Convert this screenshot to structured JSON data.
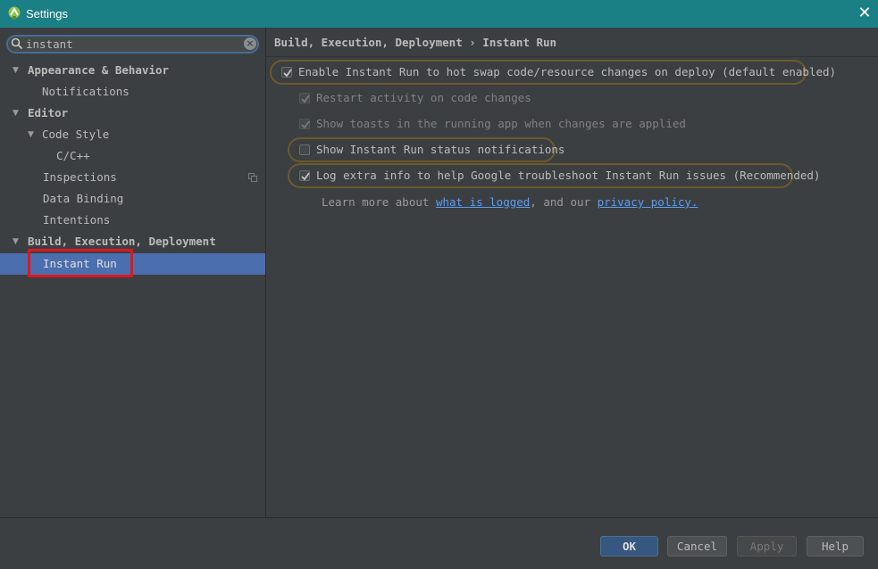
{
  "window": {
    "title": "Settings",
    "close_glyph": "✕",
    "icon": "android-studio-icon"
  },
  "search": {
    "value": "instant",
    "icon": "search-icon",
    "clear_glyph": "×"
  },
  "tree": {
    "appearance": "Appearance & Behavior",
    "notifications": "Notifications",
    "editor": "Editor",
    "code_style": "Code Style",
    "c_cpp": "C/C++",
    "inspections": "Inspections",
    "data_binding": "Data Binding",
    "intentions": "Intentions",
    "build": "Build, Execution, Deployment",
    "instant_run": "Instant Run",
    "expand_glyph": "▼"
  },
  "breadcrumb": "Build, Execution, Deployment › Instant Run",
  "options": {
    "enable_instant_run": {
      "label": "Enable Instant Run to hot swap code/resource changes on deploy (default enabled)",
      "checked": true
    },
    "restart_activity": {
      "label": "Restart activity on code changes",
      "checked": true,
      "enabled": false
    },
    "show_toasts": {
      "label": "Show toasts in the running app when changes are applied",
      "checked": true,
      "enabled": false
    },
    "status_notifications": {
      "label": "Show Instant Run status notifications",
      "checked": false
    },
    "log_extra": {
      "label": "Log extra info to help Google troubleshoot Instant Run issues (Recommended)",
      "checked": true
    }
  },
  "learn_more": {
    "prefix": "Learn more about ",
    "link1": "what is logged",
    "middle": ", and our ",
    "link2": "privacy policy."
  },
  "buttons": {
    "ok": "OK",
    "cancel": "Cancel",
    "apply": "Apply",
    "help": "Help"
  },
  "colors": {
    "titlebar": "#1b7f86",
    "background": "#3c3f41",
    "selection": "#4b6eaf",
    "link": "#589df6",
    "highlight_box": "#e2161b",
    "option_ring": "#6a5a2e"
  }
}
